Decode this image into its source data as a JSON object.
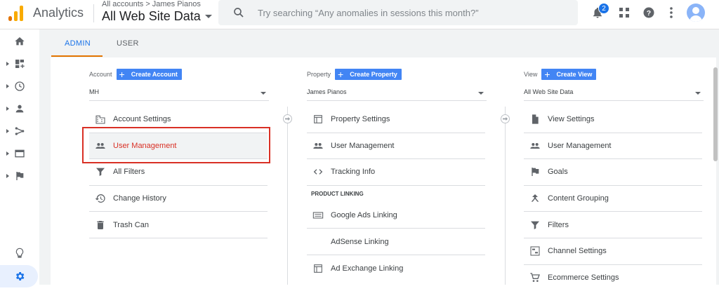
{
  "app": {
    "title": "Analytics",
    "breadcrumb": {
      "account": "All accounts",
      "separator": ">",
      "property": "James Pianos"
    },
    "view_title": "All Web Site Data",
    "search_placeholder": "Try searching “Any anomalies in sessions this month?”",
    "notifications_count": "2",
    "colors": {
      "accent": "#1a73e8",
      "create_button": "#4285f4",
      "tab_underline": "#e37400",
      "highlight": "#d93025"
    }
  },
  "rail": {
    "items": [
      {
        "icon": "home-icon"
      },
      {
        "icon": "customization-icon"
      },
      {
        "icon": "realtime-icon"
      },
      {
        "icon": "audience-icon"
      },
      {
        "icon": "acquisition-icon"
      },
      {
        "icon": "behavior-icon"
      },
      {
        "icon": "conversions-icon"
      }
    ],
    "bottom": [
      {
        "icon": "discover-icon"
      },
      {
        "icon": "admin-gear-icon"
      }
    ]
  },
  "tabs": {
    "admin": "ADMIN",
    "user": "USER",
    "active": "ADMIN"
  },
  "account": {
    "label": "Account",
    "create_label": "Create Account",
    "selected": "MH",
    "items": [
      {
        "label": "Account Settings",
        "icon": "building-icon"
      },
      {
        "label": "User Management",
        "icon": "people-icon",
        "active": true
      },
      {
        "label": "All Filters",
        "icon": "filter-icon"
      },
      {
        "label": "Change History",
        "icon": "history-icon"
      },
      {
        "label": "Trash Can",
        "icon": "trash-icon"
      }
    ]
  },
  "property": {
    "label": "Property",
    "create_label": "Create Property",
    "selected": "James Pianos",
    "items": [
      {
        "label": "Property Settings",
        "icon": "window-icon"
      },
      {
        "label": "User Management",
        "icon": "people-icon"
      },
      {
        "label": "Tracking Info",
        "icon": "code-icon"
      }
    ],
    "section_title": "PRODUCT LINKING",
    "linking_items": [
      {
        "label": "Google Ads Linking",
        "icon": "ads-icon"
      },
      {
        "label": "AdSense Linking",
        "icon": "none"
      },
      {
        "label": "Ad Exchange Linking",
        "icon": "window-icon"
      }
    ]
  },
  "view": {
    "label": "View",
    "create_label": "Create View",
    "selected": "All Web Site Data",
    "items": [
      {
        "label": "View Settings",
        "icon": "document-icon"
      },
      {
        "label": "User Management",
        "icon": "people-icon"
      },
      {
        "label": "Goals",
        "icon": "flag-icon"
      },
      {
        "label": "Content Grouping",
        "icon": "grouping-icon"
      },
      {
        "label": "Filters",
        "icon": "filter-icon"
      },
      {
        "label": "Channel Settings",
        "icon": "channel-icon"
      },
      {
        "label": "Ecommerce Settings",
        "icon": "cart-icon"
      }
    ]
  }
}
